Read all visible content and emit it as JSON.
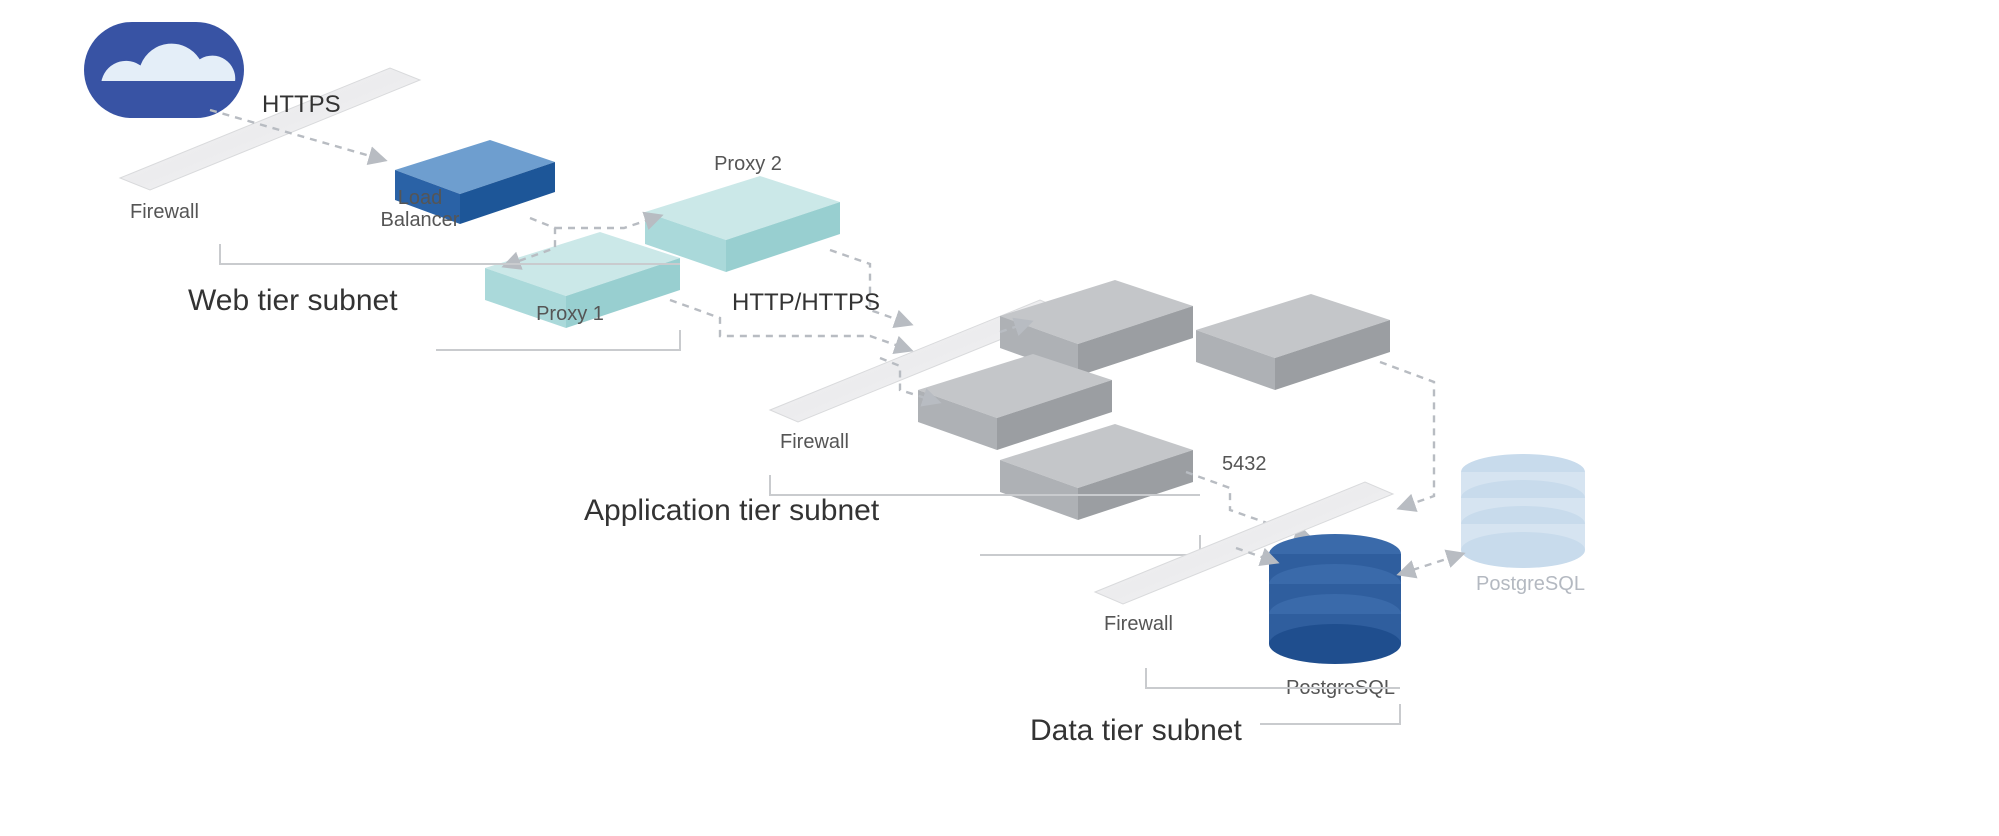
{
  "protocols": {
    "https": "HTTPS",
    "http_https": "HTTP/HTTPS",
    "port": "5432"
  },
  "nodes": {
    "firewall1": "Firewall",
    "firewall2": "Firewall",
    "firewall3": "Firewall",
    "load_balancer_l1": "Load",
    "load_balancer_l2": "Balancer",
    "proxy1": "Proxy 1",
    "proxy2": "Proxy 2",
    "db_primary": "PostgreSQL",
    "db_secondary": "PostgreSQL"
  },
  "subnets": {
    "web": "Web tier subnet",
    "app": "Application tier subnet",
    "data": "Data tier subnet"
  }
}
